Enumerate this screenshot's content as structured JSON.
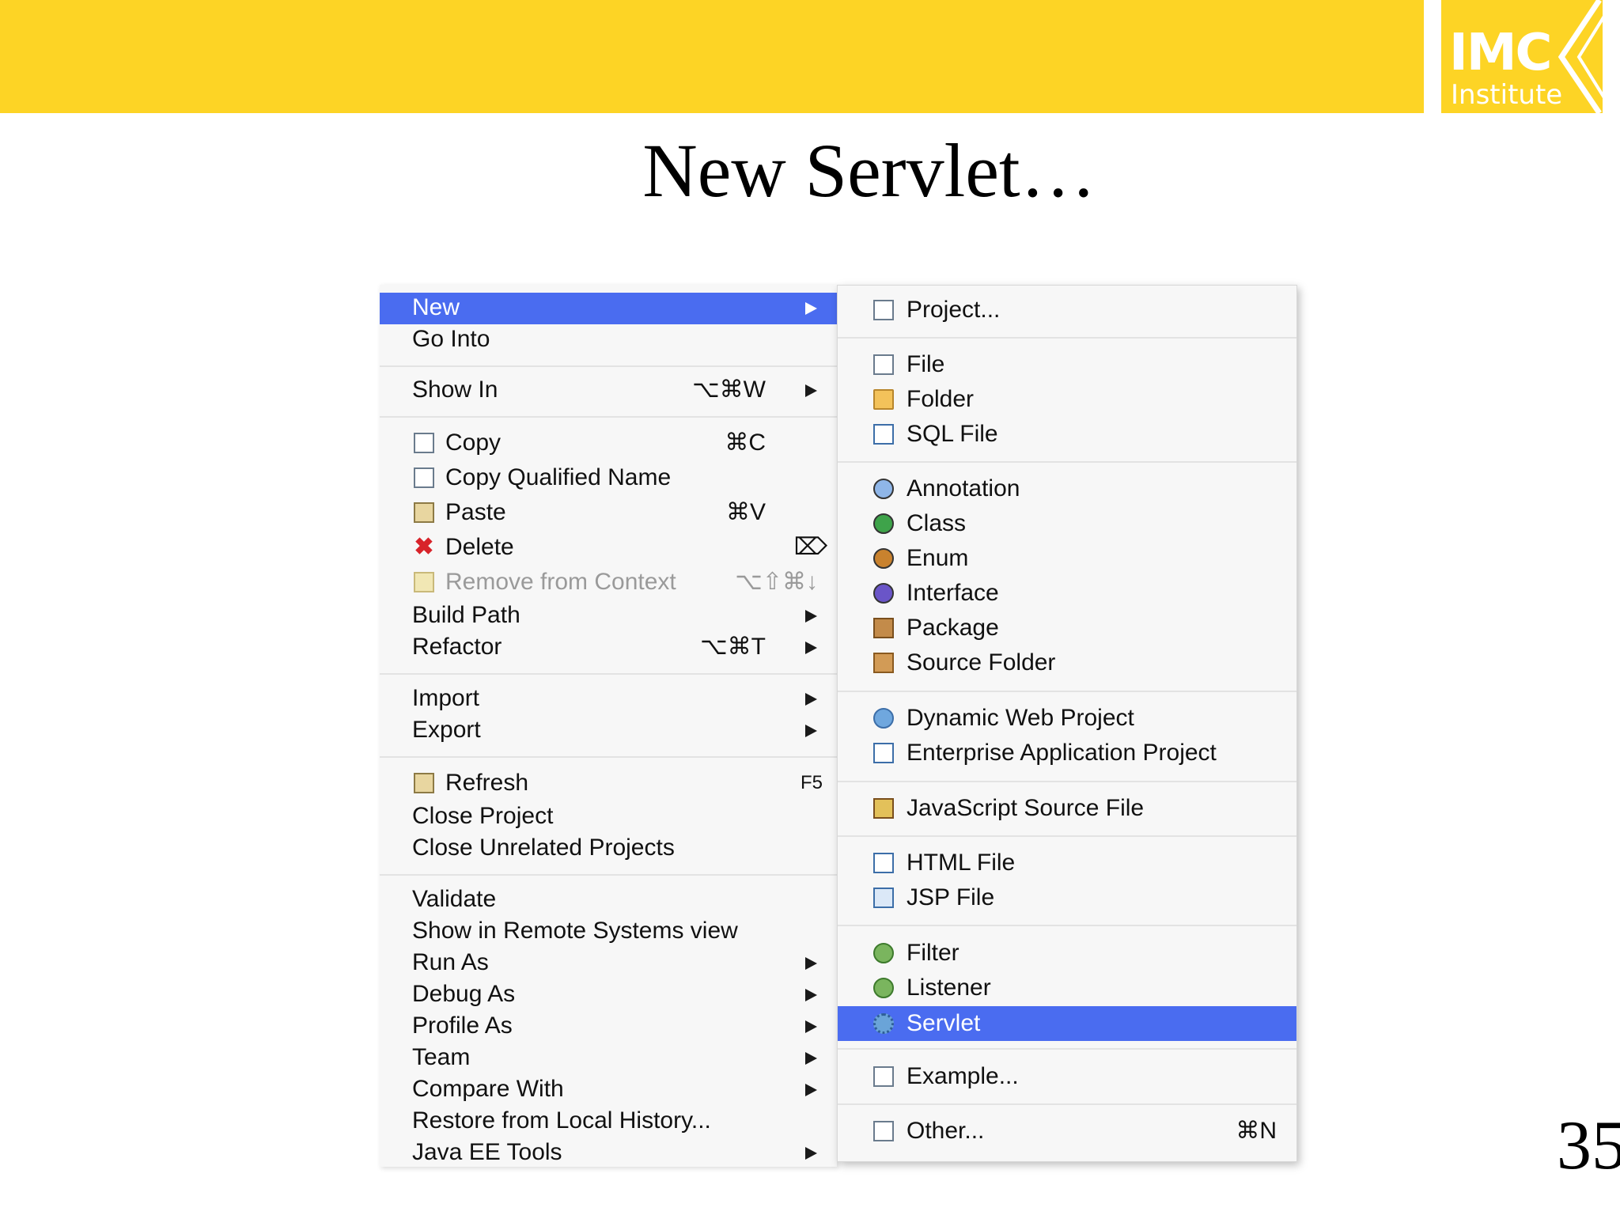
{
  "banner": {
    "color": "#fdd425"
  },
  "logo": {
    "line1": "IMC",
    "line2": "Institute"
  },
  "title": "New Servlet…",
  "page_number": "35",
  "accent_selected": "#4a6cf0",
  "context_menu": {
    "items": [
      {
        "label": "New",
        "shortcut": "",
        "submenu": true,
        "selected": true
      },
      {
        "label": "Go Into",
        "shortcut": ""
      },
      {
        "label": "Show In",
        "shortcut": "⌥⌘W",
        "submenu": true
      },
      {
        "label": "Copy",
        "shortcut": "⌘C",
        "icon": "copy-icon"
      },
      {
        "label": "Copy Qualified Name",
        "shortcut": "",
        "icon": "copy-qualified-name-icon"
      },
      {
        "label": "Paste",
        "shortcut": "⌘V",
        "icon": "paste-icon"
      },
      {
        "label": "Delete",
        "shortcut": "⌦",
        "icon": "delete-icon"
      },
      {
        "label": "Remove from Context",
        "shortcut": "⌥⇧⌘↓",
        "icon": "remove-context-icon",
        "disabled": true
      },
      {
        "label": "Build Path",
        "submenu": true
      },
      {
        "label": "Refactor",
        "shortcut": "⌥⌘T",
        "submenu": true
      },
      {
        "label": "Import",
        "submenu": true
      },
      {
        "label": "Export",
        "submenu": true
      },
      {
        "label": "Refresh",
        "shortcut": "F5",
        "icon": "refresh-icon"
      },
      {
        "label": "Close Project"
      },
      {
        "label": "Close Unrelated Projects"
      },
      {
        "label": "Validate"
      },
      {
        "label": "Show in Remote Systems view"
      },
      {
        "label": "Run As",
        "submenu": true
      },
      {
        "label": "Debug As",
        "submenu": true
      },
      {
        "label": "Profile As",
        "submenu": true
      },
      {
        "label": "Team",
        "submenu": true
      },
      {
        "label": "Compare With",
        "submenu": true
      },
      {
        "label": "Restore from Local History..."
      },
      {
        "label": "Java EE Tools",
        "submenu": true
      }
    ]
  },
  "new_submenu": {
    "items": [
      {
        "label": "Project...",
        "icon": "project-icon"
      },
      {
        "label": "File",
        "icon": "file-icon"
      },
      {
        "label": "Folder",
        "icon": "folder-icon"
      },
      {
        "label": "SQL File",
        "icon": "sql-file-icon"
      },
      {
        "label": "Annotation",
        "icon": "annotation-icon"
      },
      {
        "label": "Class",
        "icon": "class-icon"
      },
      {
        "label": "Enum",
        "icon": "enum-icon"
      },
      {
        "label": "Interface",
        "icon": "interface-icon"
      },
      {
        "label": "Package",
        "icon": "package-icon"
      },
      {
        "label": "Source Folder",
        "icon": "source-folder-icon"
      },
      {
        "label": "Dynamic Web Project",
        "icon": "dynamic-web-project-icon"
      },
      {
        "label": "Enterprise Application Project",
        "icon": "enterprise-application-project-icon"
      },
      {
        "label": "JavaScript Source File",
        "icon": "javascript-source-file-icon"
      },
      {
        "label": "HTML File",
        "icon": "html-file-icon"
      },
      {
        "label": "JSP File",
        "icon": "jsp-file-icon"
      },
      {
        "label": "Filter",
        "icon": "filter-icon"
      },
      {
        "label": "Listener",
        "icon": "listener-icon"
      },
      {
        "label": "Servlet",
        "icon": "servlet-icon",
        "selected": true
      },
      {
        "label": "Example...",
        "icon": "example-icon"
      },
      {
        "label": "Other...",
        "icon": "other-icon",
        "shortcut": "⌘N"
      }
    ]
  }
}
